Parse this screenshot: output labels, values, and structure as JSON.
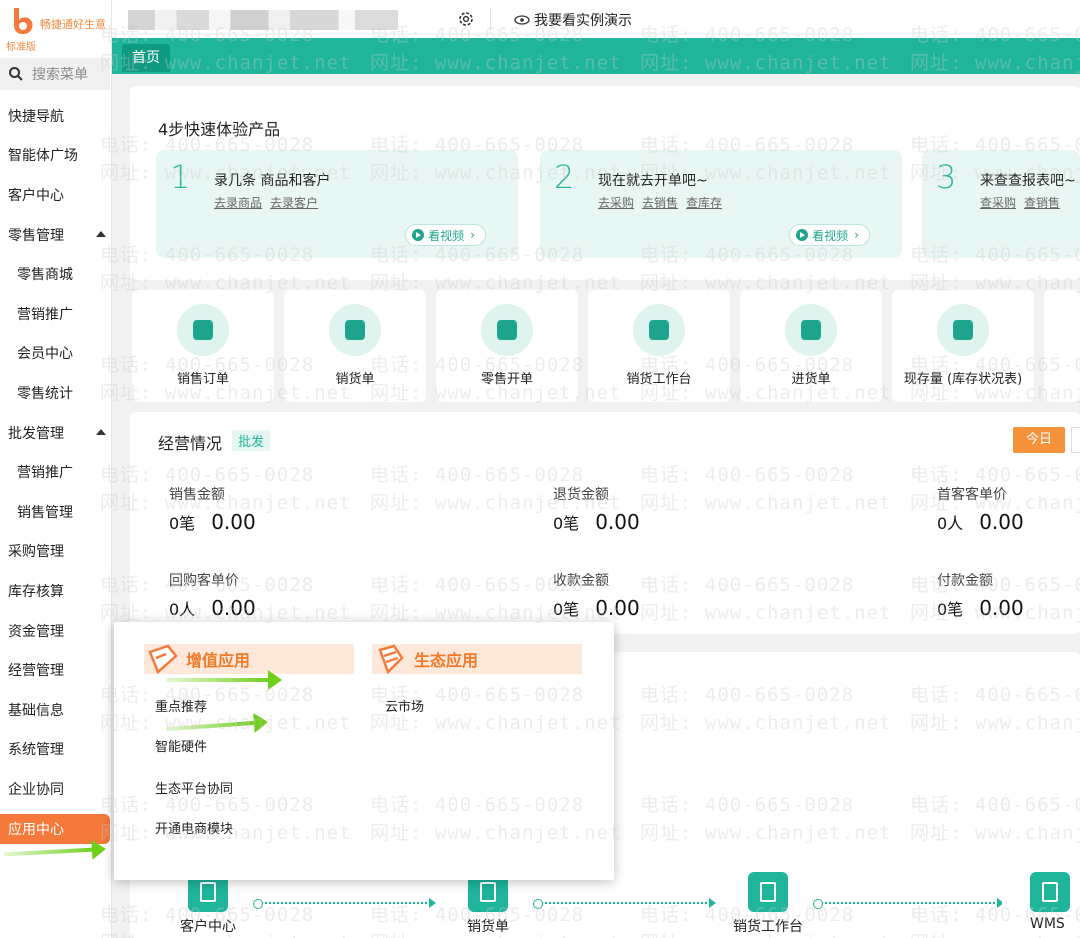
{
  "app": {
    "name": "畅捷通好生意",
    "edition": "标准版"
  },
  "sidebar": {
    "search_placeholder": "搜索菜单",
    "items": [
      {
        "label": "快捷导航",
        "level": 1
      },
      {
        "label": "智能体广场",
        "level": 1
      },
      {
        "label": "客户中心",
        "level": 1
      },
      {
        "label": "零售管理",
        "level": 1,
        "expanded": true
      },
      {
        "label": "零售商城",
        "level": 2
      },
      {
        "label": "营销推广",
        "level": 2
      },
      {
        "label": "会员中心",
        "level": 2
      },
      {
        "label": "零售统计",
        "level": 2
      },
      {
        "label": "批发管理",
        "level": 1,
        "expanded": true
      },
      {
        "label": "营销推广",
        "level": 2
      },
      {
        "label": "销售管理",
        "level": 2
      },
      {
        "label": "采购管理",
        "level": 1
      },
      {
        "label": "库存核算",
        "level": 1
      },
      {
        "label": "资金管理",
        "level": 1
      },
      {
        "label": "经营管理",
        "level": 1
      },
      {
        "label": "基础信息",
        "level": 1
      },
      {
        "label": "系统管理",
        "level": 1
      },
      {
        "label": "企业协同",
        "level": 1
      },
      {
        "label": "应用中心",
        "level": 1,
        "active": true
      }
    ]
  },
  "topbar": {
    "demo_label": "我要看实例演示",
    "icons": [
      "gear-icon",
      "eye-icon"
    ]
  },
  "tabs": [
    {
      "label": "首页",
      "active": true
    }
  ],
  "steps": {
    "title": "4步快速体验产品",
    "cards": [
      {
        "num": "1",
        "title": "录几条 商品和客户",
        "links": [
          "去录商品",
          "去录客户"
        ],
        "video": "看视频"
      },
      {
        "num": "2",
        "title": "现在就去开单吧~",
        "links": [
          "去采购",
          "去销售",
          "查库存"
        ],
        "video": "看视频"
      },
      {
        "num": "3",
        "title": "来查查报表吧~",
        "links": [
          "查采购",
          "查销售"
        ]
      }
    ]
  },
  "quick_actions": [
    "销售订单",
    "销货单",
    "零售开单",
    "销货工作台",
    "进货单",
    "现存量 (库存状况表)"
  ],
  "business": {
    "title": "经营情况",
    "tag": "批发",
    "period_button": "今日",
    "metrics": [
      {
        "label": "销售金额",
        "count": "0笔",
        "amount": "0.00"
      },
      {
        "label": "退货金额",
        "count": "0笔",
        "amount": "0.00"
      },
      {
        "label": "首客客单价",
        "count": "0人",
        "amount": "0.00"
      },
      {
        "label": "回购客单价",
        "count": "0人",
        "amount": "0.00"
      },
      {
        "label": "收款金额",
        "count": "0笔",
        "amount": "0.00"
      },
      {
        "label": "付款金额",
        "count": "0笔",
        "amount": "0.00"
      }
    ]
  },
  "flow": [
    "客户中心",
    "销货单",
    "销货工作台",
    "WMS"
  ],
  "popup": {
    "groups": [
      {
        "title": "增值应用",
        "items": [
          "重点推荐",
          "智能硬件",
          "生态平台协同",
          "开通电商模块"
        ]
      },
      {
        "title": "生态应用",
        "items": [
          "云市场"
        ]
      }
    ]
  },
  "watermark": {
    "phone": "电话: 400-665-0028",
    "site": "网址: www.chanjet.net"
  },
  "colors": {
    "brand_teal": "#1fb59b",
    "accent_orange": "#f5793a",
    "arrow_green": "#6fcf1b"
  }
}
